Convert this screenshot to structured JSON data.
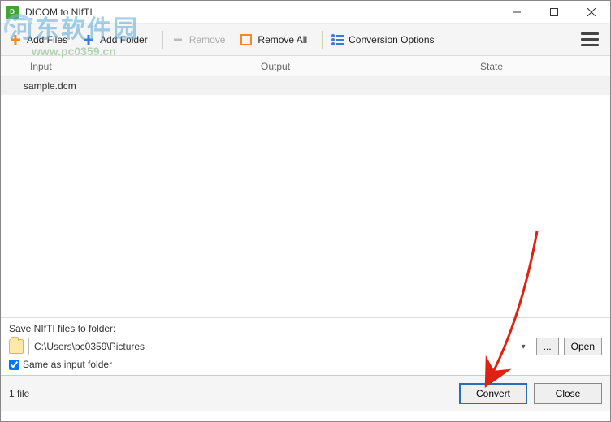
{
  "window": {
    "title": "DICOM to NIfTI"
  },
  "toolbar": {
    "addFiles": "Add Files",
    "addFolder": "Add Folder",
    "remove": "Remove",
    "removeAll": "Remove All",
    "convOptions": "Conversion Options"
  },
  "columns": {
    "input": "Input",
    "output": "Output",
    "state": "State"
  },
  "rows": [
    {
      "input": "sample.dcm",
      "output": "",
      "state": ""
    }
  ],
  "save": {
    "label": "Save NIfTI files to folder:",
    "path": "C:\\Users\\pc0359\\Pictures",
    "browse": "...",
    "open": "Open",
    "sameAs": "Same as input folder",
    "sameAsChecked": true
  },
  "footer": {
    "status": "1 file",
    "convert": "Convert",
    "close": "Close"
  },
  "watermark": {
    "text": "河东软件园",
    "url": "www.pc0359.cn"
  }
}
